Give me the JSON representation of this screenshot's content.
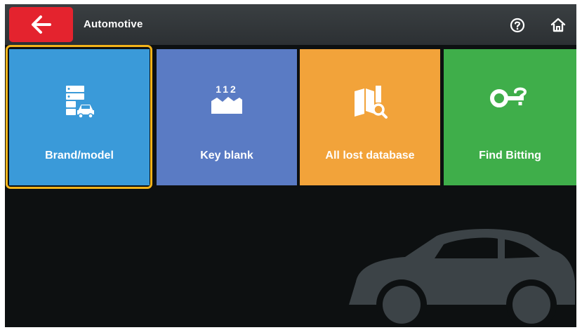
{
  "header": {
    "title": "Automotive",
    "back_icon": "arrow-left-icon",
    "help_icon": "help-circle-icon",
    "home_icon": "home-icon"
  },
  "tiles": [
    {
      "label": "Brand/model",
      "icon": "database-car-icon",
      "color": "#3a9ad9",
      "selected": true
    },
    {
      "label": "Key blank",
      "icon": "key-blank-112-icon",
      "icon_text": "112",
      "color": "#5a7bc4",
      "selected": false
    },
    {
      "label": "All lost database",
      "icon": "book-search-icon",
      "color": "#f2a33a",
      "selected": false
    },
    {
      "label": "Find Bitting",
      "icon": "key-question-icon",
      "color": "#3fae4a",
      "selected": false
    }
  ],
  "colors": {
    "back_button": "#e4232e",
    "focus_ring": "#f4b41a",
    "background": "#0d1011"
  }
}
